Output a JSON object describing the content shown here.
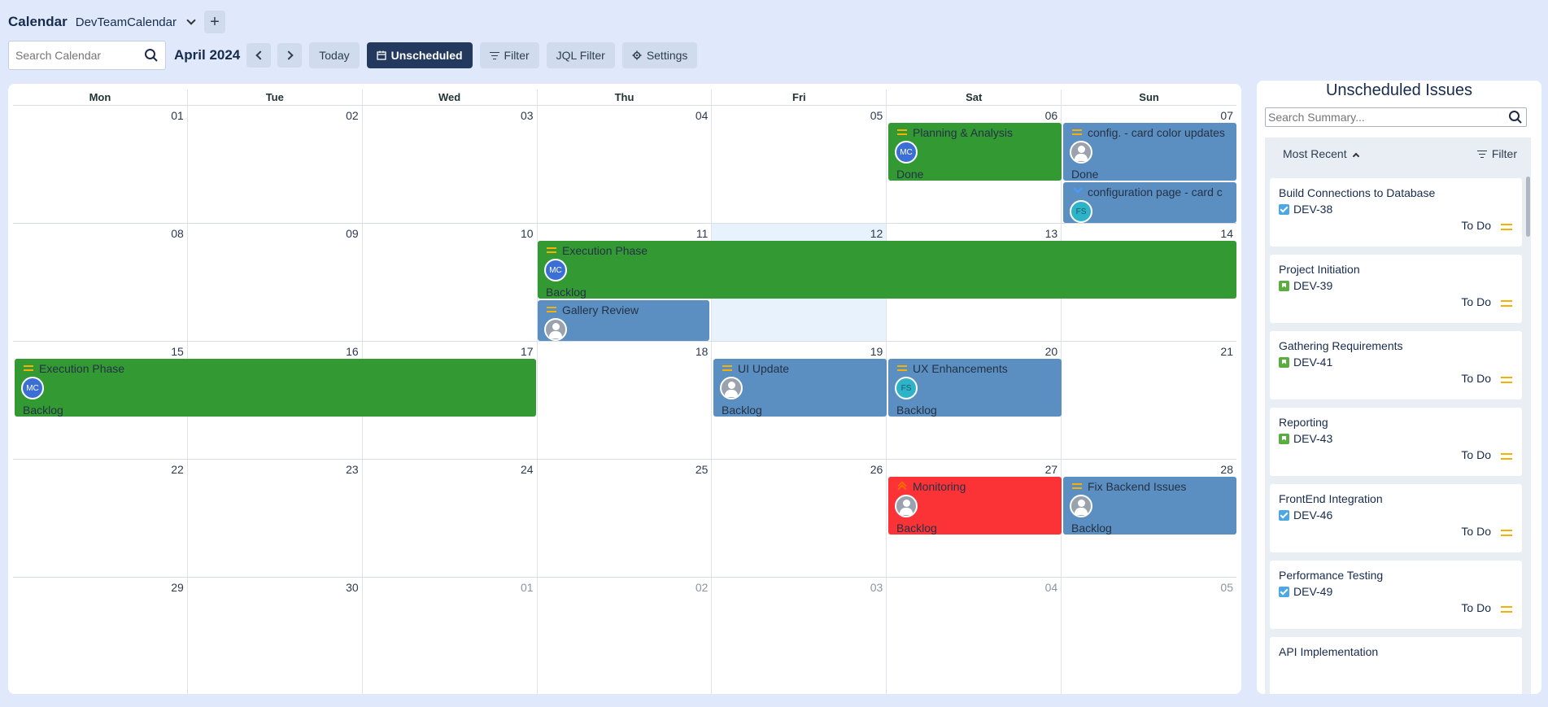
{
  "header": {
    "app_title": "Calendar",
    "calendar_name": "DevTeamCalendar",
    "add_label": "+"
  },
  "toolbar": {
    "search_placeholder": "Search Calendar",
    "month": "April 2024",
    "today_label": "Today",
    "unscheduled_label": "Unscheduled",
    "filter_label": "Filter",
    "jql_label": "JQL Filter",
    "settings_label": "Settings"
  },
  "calendar": {
    "weekdays": [
      "Mon",
      "Tue",
      "Wed",
      "Thu",
      "Fri",
      "Sat",
      "Sun"
    ],
    "weeks": [
      [
        "01",
        "02",
        "03",
        "04",
        "05",
        "06",
        "07"
      ],
      [
        "08",
        "09",
        "10",
        "11",
        "12",
        "13",
        "14"
      ],
      [
        "15",
        "16",
        "17",
        "18",
        "19",
        "20",
        "21"
      ],
      [
        "22",
        "23",
        "24",
        "25",
        "26",
        "27",
        "28"
      ],
      [
        "29",
        "30",
        "01",
        "02",
        "03",
        "04",
        "05"
      ]
    ],
    "today": "12",
    "events": [
      {
        "title": "Planning & Analysis",
        "status": "Done",
        "assignee": "MC",
        "color": "#339933",
        "priority": "medium"
      },
      {
        "title": "config. - card color updates",
        "status": "Done",
        "assignee": "",
        "color": "#5b8fc2",
        "priority": "medium"
      },
      {
        "title": "configuration page - card c",
        "status": "",
        "assignee": "FS",
        "color": "#5b8fc2",
        "priority": "low"
      },
      {
        "title": "Execution Phase",
        "status": "Backlog",
        "assignee": "MC",
        "color": "#339933",
        "priority": "medium"
      },
      {
        "title": "Gallery Review",
        "status": "",
        "assignee": "",
        "color": "#5b8fc2",
        "priority": "medium"
      },
      {
        "title": "Execution Phase",
        "status": "Backlog",
        "assignee": "MC",
        "color": "#339933",
        "priority": "medium"
      },
      {
        "title": "UI Update",
        "status": "Backlog",
        "assignee": "",
        "color": "#5b8fc2",
        "priority": "medium"
      },
      {
        "title": "UX Enhancements",
        "status": "Backlog",
        "assignee": "FS",
        "color": "#5b8fc2",
        "priority": "medium"
      },
      {
        "title": "Monitoring",
        "status": "Backlog",
        "assignee": "",
        "color": "#fb3337",
        "priority": "high"
      },
      {
        "title": "Fix Backend Issues",
        "status": "Backlog",
        "assignee": "",
        "color": "#5b8fc2",
        "priority": "medium"
      }
    ]
  },
  "sidebar": {
    "title": "Unscheduled Issues",
    "search_placeholder": "Search Summary...",
    "sort_label": "Most Recent",
    "filter_label": "Filter",
    "issues": [
      {
        "title": "Build Connections to Database",
        "key": "DEV-38",
        "type": "task",
        "status": "To Do"
      },
      {
        "title": "Project Initiation",
        "key": "DEV-39",
        "type": "story",
        "status": "To Do"
      },
      {
        "title": "Gathering Requirements",
        "key": "DEV-41",
        "type": "story",
        "status": "To Do"
      },
      {
        "title": "Reporting",
        "key": "DEV-43",
        "type": "story",
        "status": "To Do"
      },
      {
        "title": "FrontEnd Integration",
        "key": "DEV-46",
        "type": "task",
        "status": "To Do"
      },
      {
        "title": "Performance Testing",
        "key": "DEV-49",
        "type": "task",
        "status": "To Do"
      },
      {
        "title": "API Implementation",
        "key": "",
        "type": "",
        "status": ""
      }
    ]
  }
}
